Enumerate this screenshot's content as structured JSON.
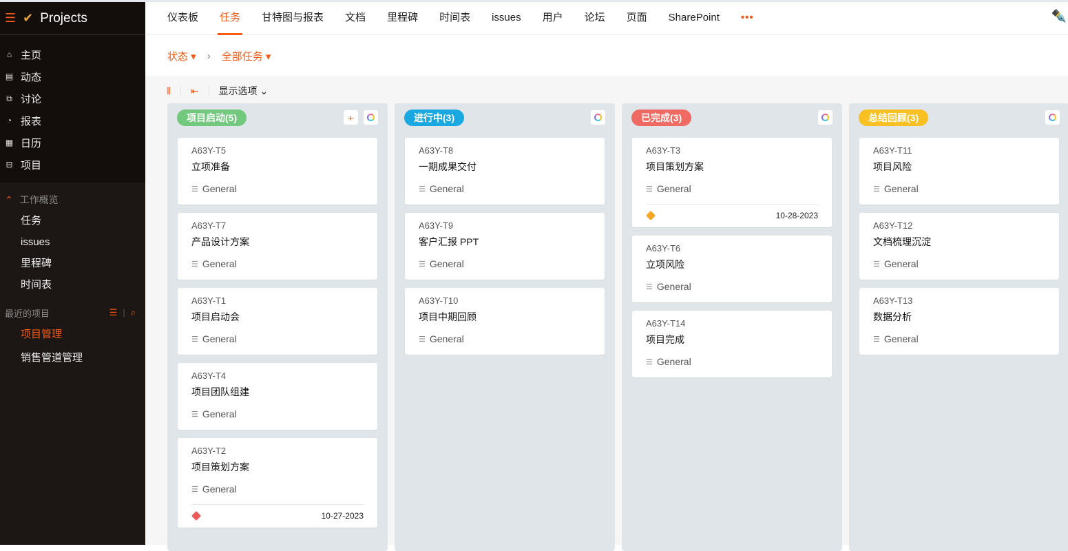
{
  "app": {
    "title": "Projects"
  },
  "sidebar": {
    "nav": [
      {
        "label": "主页",
        "icon": "home-icon",
        "g": "⌂"
      },
      {
        "label": "动态",
        "icon": "feed-icon",
        "g": "▤"
      },
      {
        "label": "讨论",
        "icon": "discussion-icon",
        "g": "⧉"
      },
      {
        "label": "报表",
        "icon": "report-icon",
        "g": "◔"
      },
      {
        "label": "日历",
        "icon": "calendar-icon",
        "g": "▦"
      },
      {
        "label": "项目",
        "icon": "briefcase-icon",
        "g": "⊟"
      }
    ],
    "section": "工作概览",
    "sub": [
      "任务",
      "issues",
      "里程碑",
      "时间表"
    ],
    "recent_label": "最近的项目",
    "projects": [
      "项目管理",
      "销售管道管理"
    ]
  },
  "tabs": [
    "仪表板",
    "任务",
    "甘特图与报表",
    "文档",
    "里程碑",
    "时间表",
    "issues",
    "用户",
    "论坛",
    "页面",
    "SharePoint"
  ],
  "more": "•••",
  "breadcrumb": {
    "status": "状态",
    "all": "全部任务"
  },
  "toolbar": {
    "display_options": "显示选项"
  },
  "colors": {
    "accent": "#f65a16"
  },
  "columns": [
    {
      "title": "项目启动",
      "count": "(5)",
      "color": "#72c97e",
      "add": true,
      "cards": [
        {
          "id": "A63Y-T5",
          "name": "立项准备",
          "tag": "General"
        },
        {
          "id": "A63Y-T7",
          "name": "产品设计方案",
          "tag": "General"
        },
        {
          "id": "A63Y-T1",
          "name": "项目启动会",
          "tag": "General"
        },
        {
          "id": "A63Y-T4",
          "name": "项目团队组建",
          "tag": "General"
        },
        {
          "id": "A63Y-T2",
          "name": "项目策划方案",
          "tag": "General",
          "date": "10-27-2023",
          "flag": "#ee5a5a"
        }
      ]
    },
    {
      "title": "进行中",
      "count": "(3)",
      "color": "#1aa8e0",
      "cards": [
        {
          "id": "A63Y-T8",
          "name": "一期成果交付",
          "tag": "General"
        },
        {
          "id": "A63Y-T9",
          "name": "客户汇报 PPT",
          "tag": "General"
        },
        {
          "id": "A63Y-T10",
          "name": "项目中期回顾",
          "tag": "General"
        }
      ]
    },
    {
      "title": "已完成",
      "count": "(3)",
      "color": "#ee6a62",
      "cards": [
        {
          "id": "A63Y-T3",
          "name": "项目策划方案",
          "tag": "General",
          "date": "10-28-2023",
          "flag": "#f5a623"
        },
        {
          "id": "A63Y-T6",
          "name": "立项风险",
          "tag": "General"
        },
        {
          "id": "A63Y-T14",
          "name": "项目完成",
          "tag": "General"
        }
      ]
    },
    {
      "title": "总结回顾",
      "count": "(3)",
      "color": "#f8c022",
      "cards": [
        {
          "id": "A63Y-T11",
          "name": "项目风险",
          "tag": "General"
        },
        {
          "id": "A63Y-T12",
          "name": "文档梳理沉淀",
          "tag": "General"
        },
        {
          "id": "A63Y-T13",
          "name": "数据分析",
          "tag": "General"
        }
      ]
    }
  ]
}
